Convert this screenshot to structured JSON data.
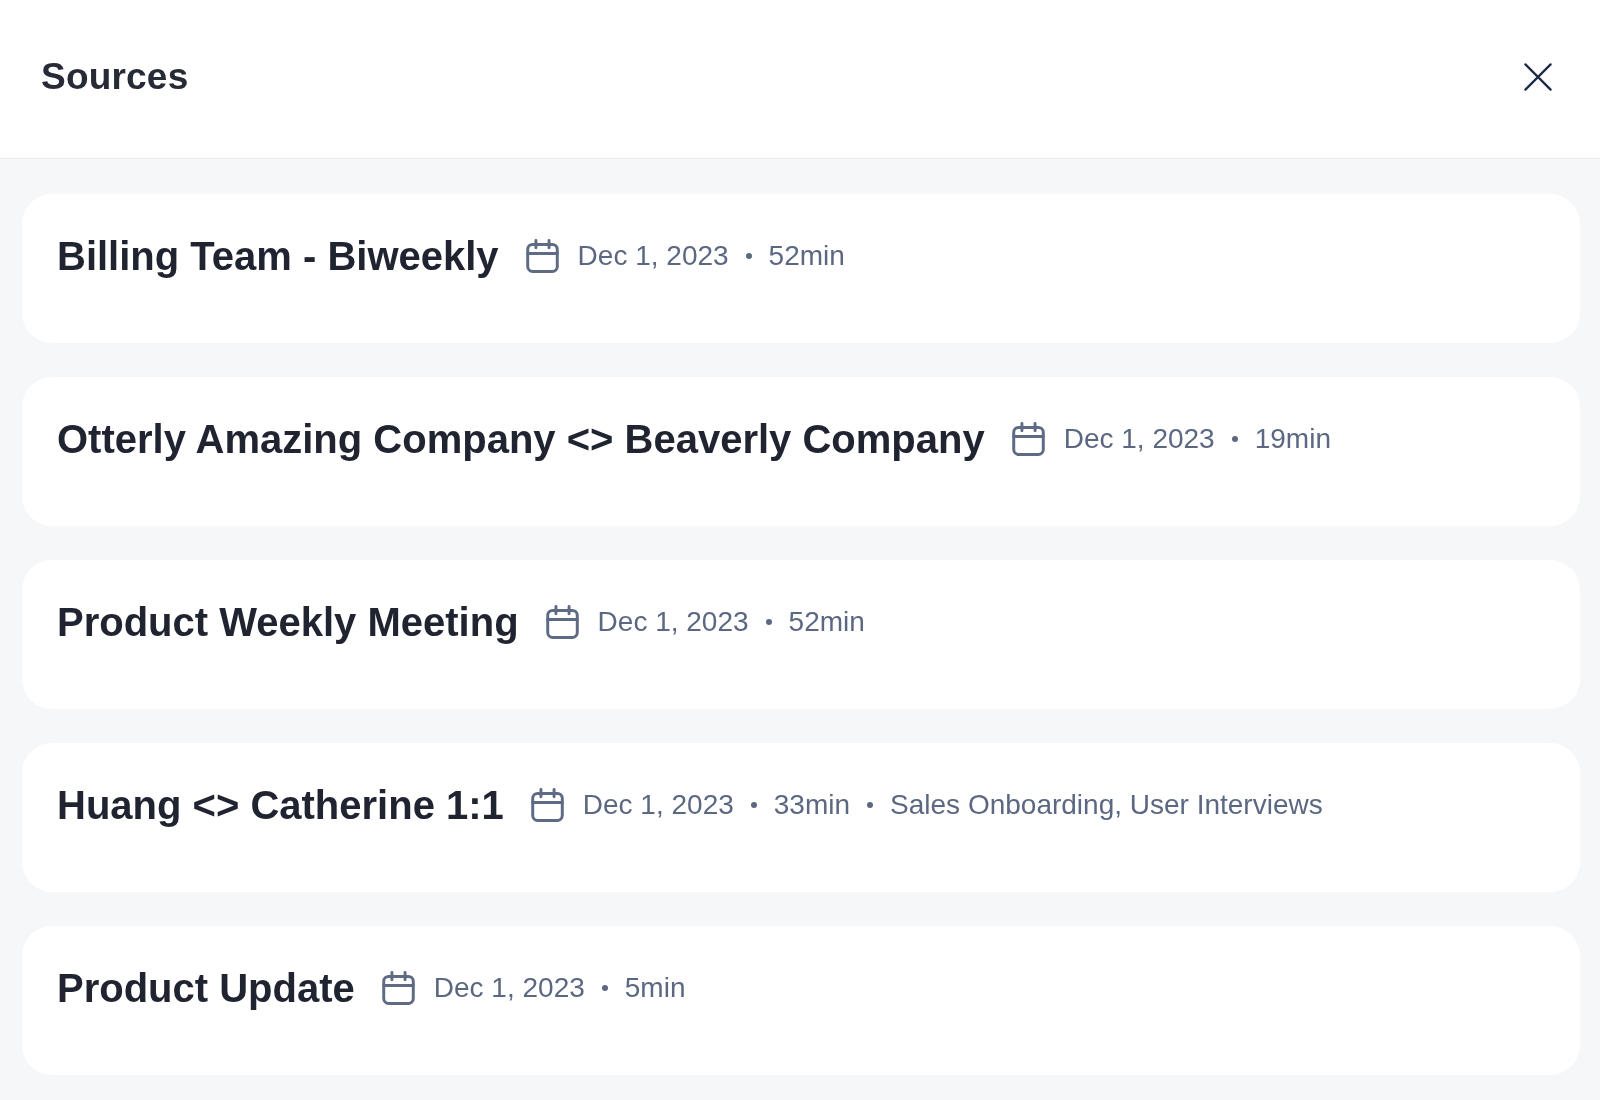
{
  "header": {
    "title": "Sources"
  },
  "sources": [
    {
      "title": "Billing Team - Biweekly",
      "date": "Dec 1, 2023",
      "duration": "52min"
    },
    {
      "title": "Otterly Amazing Company <> Beaverly Company",
      "date": "Dec 1, 2023",
      "duration": "19min"
    },
    {
      "title": "Product Weekly Meeting",
      "date": "Dec 1, 2023",
      "duration": "52min"
    },
    {
      "title": "Huang <> Catherine 1:1",
      "date": "Dec 1, 2023",
      "duration": "33min",
      "tags": "Sales Onboarding, User Interviews"
    },
    {
      "title": "Product Update",
      "date": "Dec 1, 2023",
      "duration": "5min"
    }
  ]
}
